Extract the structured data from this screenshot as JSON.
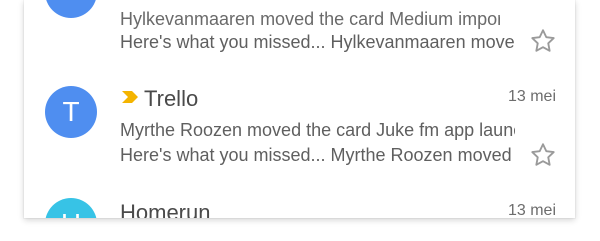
{
  "mail_list": {
    "items": [
      {
        "avatar_letter": "",
        "avatar_color": "#4f8ef0",
        "subject_preview": "Hylkevanmaaren moved the card Medium import...",
        "snippet": "Here's what you missed... Hylkevanmaaren moved...",
        "starred": false
      },
      {
        "avatar_letter": "T",
        "avatar_color": "#4f8ef0",
        "sender": "Trello",
        "date": "13 mei",
        "important_marker": true,
        "important_color": "#f4b400",
        "subject_preview": "Myrthe Roozen moved the card Juke fm app launc...",
        "snippet": "Here's what you missed... Myrthe Roozen moved t...",
        "starred": false
      },
      {
        "avatar_letter": "H",
        "avatar_color": "#37c3e6",
        "sender": "Homerun",
        "date": "13 mei"
      }
    ]
  },
  "icons": {
    "star": "star-outline-icon",
    "important": "important-marker-icon"
  }
}
